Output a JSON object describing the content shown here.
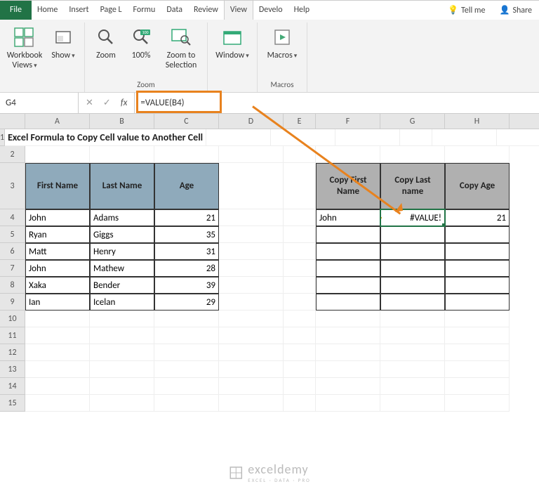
{
  "ribbon": {
    "tabs": [
      "File",
      "Home",
      "Insert",
      "Page L",
      "Formu",
      "Data",
      "Review",
      "View",
      "Develo",
      "Help"
    ],
    "active_tab": "View",
    "tellme_label": "Tell me",
    "share_label": "Share",
    "groups": {
      "views": {
        "workbook_views": "Workbook Views",
        "show": "Show"
      },
      "zoom": {
        "label": "Zoom",
        "zoom": "Zoom",
        "hundred": "100%",
        "zoom_sel": "Zoom to Selection"
      },
      "window": {
        "label": "Window"
      },
      "macros": {
        "label": "Macros",
        "btn": "Macros"
      }
    }
  },
  "formula_bar": {
    "name_box": "G4",
    "formula": "=VALUE(B4)"
  },
  "columns": [
    "A",
    "B",
    "C",
    "D",
    "E",
    "F",
    "G",
    "H"
  ],
  "row_numbers": [
    "1",
    "2",
    "3",
    "4",
    "5",
    "6",
    "7",
    "8",
    "9",
    "10",
    "11",
    "12",
    "13",
    "14",
    "15"
  ],
  "title_text": "Excel Formula to Copy Cell value to Another Cell",
  "table1": {
    "headers": {
      "first": "First Name",
      "last": "Last Name",
      "age": "Age"
    },
    "rows": [
      {
        "first": "John",
        "last": "Adams",
        "age": "21"
      },
      {
        "first": "Ryan",
        "last": "Giggs",
        "age": "35"
      },
      {
        "first": "Matt",
        "last": "Henry",
        "age": "31"
      },
      {
        "first": "John",
        "last": "Mathew",
        "age": "28"
      },
      {
        "first": "Xaka",
        "last": "Bender",
        "age": "39"
      },
      {
        "first": "Ian",
        "last": "Icelan",
        "age": "29"
      }
    ]
  },
  "table2": {
    "headers": {
      "first": "Copy First Name",
      "last": "Copy Last name",
      "age": "Copy Age"
    },
    "rows": [
      {
        "first": "John",
        "last": "#VALUE!",
        "age": "21"
      }
    ]
  },
  "watermark": {
    "brand": "exceldemy",
    "sub": "EXCEL · DATA · PRO"
  }
}
